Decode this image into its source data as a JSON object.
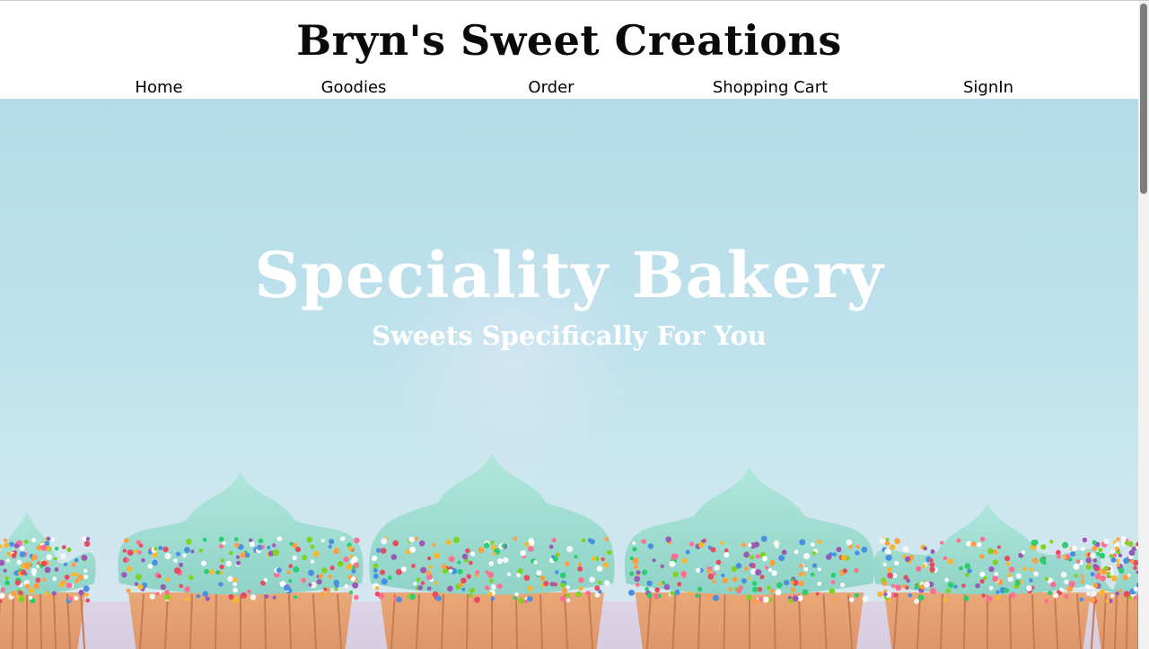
{
  "header": {
    "site_title": "Bryn's Sweet Creations"
  },
  "nav": {
    "items": [
      {
        "label": "Home"
      },
      {
        "label": "Goodies"
      },
      {
        "label": "Order"
      },
      {
        "label": "Shopping Cart"
      },
      {
        "label": "SignIn"
      }
    ]
  },
  "hero": {
    "heading": "Speciality Bakery",
    "subheading": "Sweets Specifically For You",
    "background_image": "cupcakes-with-sprinkles",
    "background_color": "#b8dde9",
    "frosting_color": "#9fdcd0"
  },
  "colors": {
    "header_background": "#ffffff",
    "title_text": "#0a0a0a",
    "hero_text": "#ffffff"
  }
}
